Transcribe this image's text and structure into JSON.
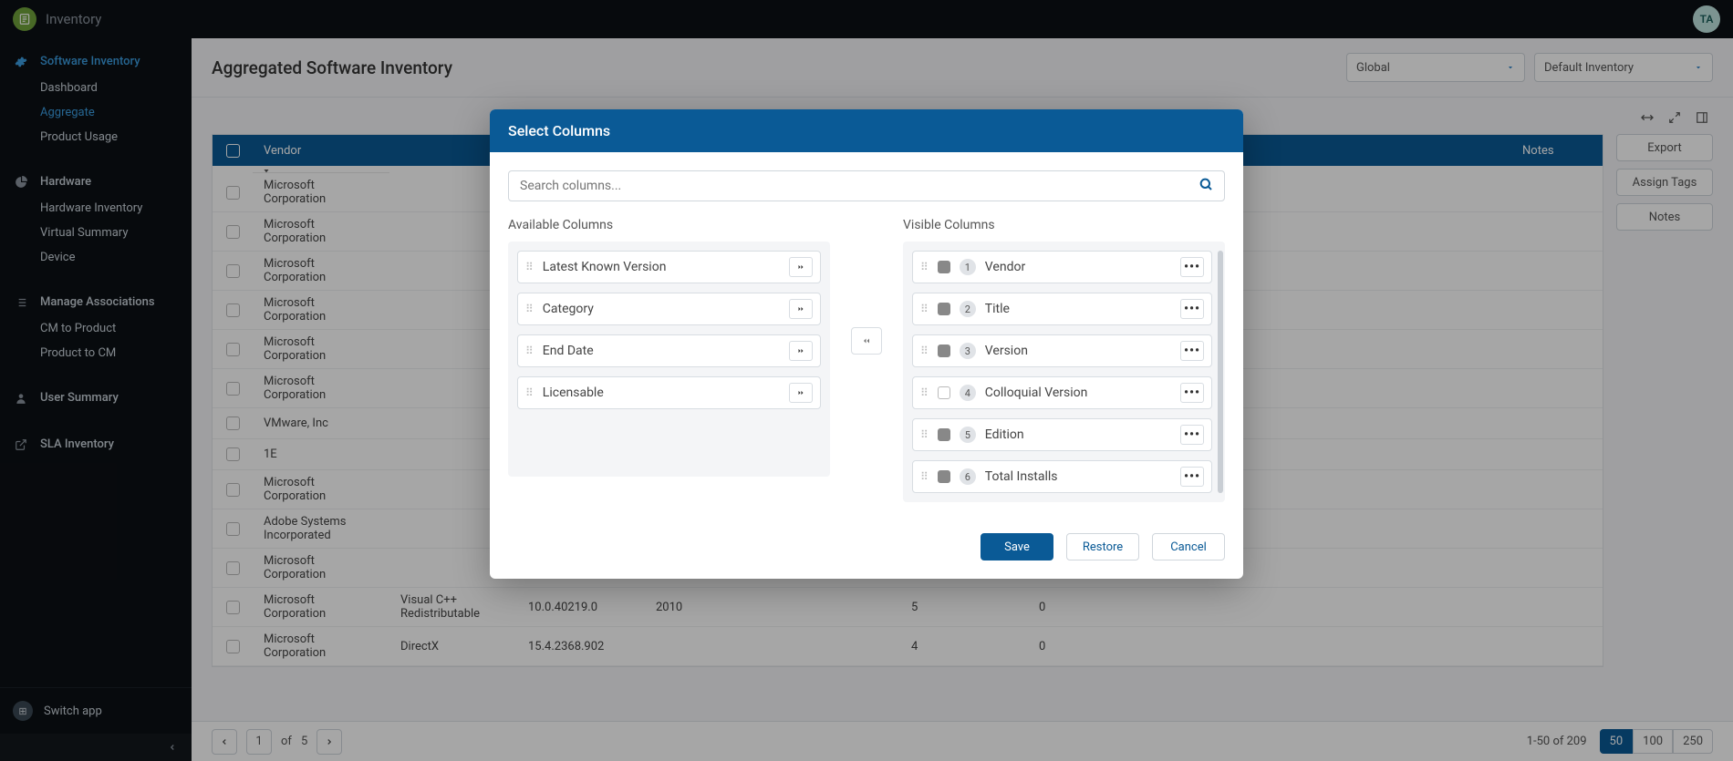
{
  "app": {
    "title": "Inventory",
    "avatar": "TA"
  },
  "sidebar": {
    "software": {
      "label": "Software Inventory",
      "items": [
        "Dashboard",
        "Aggregate",
        "Product Usage"
      ]
    },
    "hardware": {
      "label": "Hardware",
      "items": [
        "Hardware Inventory",
        "Virtual Summary",
        "Device"
      ]
    },
    "manage": {
      "label": "Manage Associations",
      "items": [
        "CM to Product",
        "Product to CM"
      ]
    },
    "user": {
      "label": "User Summary"
    },
    "sla": {
      "label": "SLA Inventory"
    },
    "switch": "Switch app"
  },
  "page": {
    "title": "Aggregated Software Inventory",
    "scope": "Global",
    "inventory": "Default Inventory"
  },
  "columns": {
    "vendor": "Vendor",
    "notes": "Notes"
  },
  "rows": [
    {
      "vendor": "Microsoft Corporation"
    },
    {
      "vendor": "Microsoft Corporation"
    },
    {
      "vendor": "Microsoft Corporation"
    },
    {
      "vendor": "Microsoft Corporation"
    },
    {
      "vendor": "Microsoft Corporation"
    },
    {
      "vendor": "Microsoft Corporation"
    },
    {
      "vendor": "VMware, Inc"
    },
    {
      "vendor": "1E"
    },
    {
      "vendor": "Microsoft Corporation"
    },
    {
      "vendor": "Adobe Systems Incorporated"
    },
    {
      "vendor": "Microsoft Corporation"
    },
    {
      "vendor": "Microsoft Corporation",
      "title": "Visual C++ Redistributable",
      "version": "10.0.40219.0",
      "coll": "2010",
      "inst": "5",
      "other": "0"
    },
    {
      "vendor": "Microsoft Corporation",
      "title": "DirectX",
      "version": "15.4.2368.902",
      "coll": "",
      "inst": "4",
      "other": "0"
    }
  ],
  "sideActions": [
    "Export",
    "Assign Tags",
    "Notes"
  ],
  "pagination": {
    "page": "1",
    "of": "of",
    "total": "5",
    "range": "1-50 of 209",
    "sizes": [
      "50",
      "100",
      "250"
    ]
  },
  "modal": {
    "title": "Select Columns",
    "searchPlaceholder": "Search columns...",
    "availableLabel": "Available Columns",
    "visibleLabel": "Visible Columns",
    "available": [
      "Latest Known Version",
      "Category",
      "End Date",
      "Licensable"
    ],
    "visible": [
      "Vendor",
      "Title",
      "Version",
      "Colloquial Version",
      "Edition",
      "Total Installs"
    ],
    "visibleChecked": [
      true,
      true,
      true,
      false,
      true,
      true
    ],
    "save": "Save",
    "restore": "Restore",
    "cancel": "Cancel"
  }
}
